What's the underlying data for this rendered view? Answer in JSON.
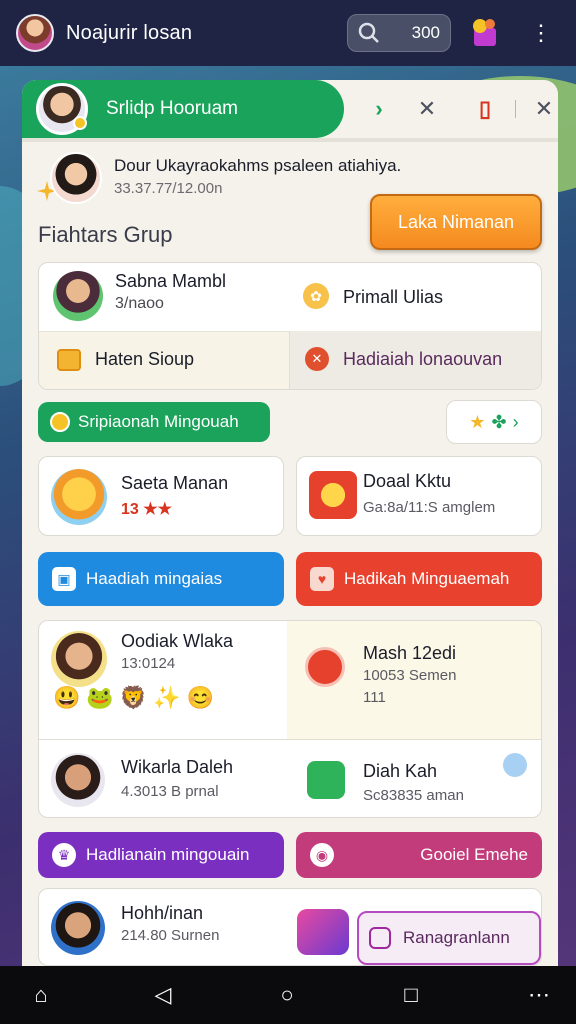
{
  "app": {
    "title": "Noajurir losan",
    "search_count": "300"
  },
  "header": {
    "title": "Srlidp Hooruam"
  },
  "notice": {
    "text": "Dour Ukayraokahms psaleen atiahiya.",
    "sub": "33.37.77/12.00n"
  },
  "section": {
    "title": "Fiahtars Grup",
    "cta_label": "Laka Nimanan"
  },
  "group": {
    "member_name": "Sabna Mambl",
    "member_sub": "3/naoo",
    "item1": "Primall Ulias",
    "item2": "Haten Sioup",
    "item3": "Hadiaiah lonaouvan"
  },
  "weekly": {
    "pill_label": "Sripiaonah Mingouah",
    "star_chip": "★ ⬥ ›"
  },
  "cards": {
    "c1_name": "Saeta Manan",
    "c1_sub": "13 ★★",
    "c2_name": "Doaal Kktu",
    "c2_sub": "Ga:8a/11:S amglem"
  },
  "buttons": {
    "b1": "Haadiah mingaias",
    "b2": "Hadikah Minguaemah"
  },
  "list": {
    "p1_name": "Oodiak Wlaka",
    "p1_sub": "13:0124",
    "p2_name": "Mash 12edi",
    "p2_sub": "10053 Semen",
    "p2_sub2": "111",
    "p3_name": "Wikarla Daleh",
    "p3_sub": "4.3013 B prnal",
    "p4_name": "Diah Kah",
    "p4_sub": "Sc83835 aman"
  },
  "buttons2": {
    "b3": "Hadlianain mingouain",
    "b4": "Gooiel Emehe"
  },
  "last": {
    "name": "Hohh/inan",
    "sub": "214.80 Surnen",
    "action": "Ranagranlann"
  },
  "colors": {
    "green": "#1ba25b",
    "orange": "#f58a1f",
    "blue": "#1e8ae0",
    "red": "#e8412e",
    "purple": "#7a2fc0",
    "magenta": "#c23b7a"
  }
}
